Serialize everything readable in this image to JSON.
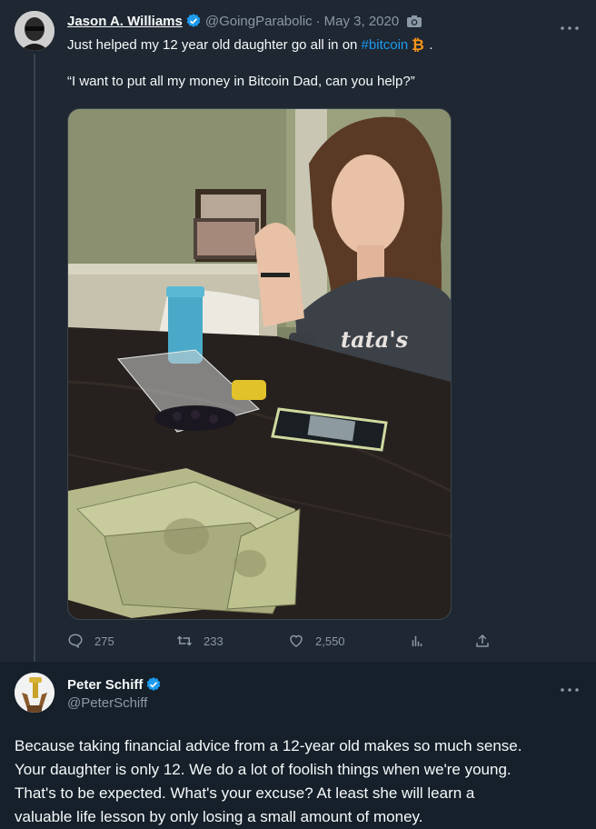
{
  "colors": {
    "bg_highlight": "#1e2732",
    "bg": "#15202b",
    "accent": "#1d9bf0",
    "muted": "#8b98a5",
    "text": "#f7f9f9"
  },
  "tweet1": {
    "name": "Jason A. Williams",
    "handle": "@GoingParabolic",
    "separator": "·",
    "date": "May 3, 2020",
    "text_pre": "Just helped my 12 year old daughter go all in on",
    "hashtag": "#bitcoin",
    "text_post": ".",
    "quote": "“I want to put all my money in Bitcoin Dad, can you help?”",
    "icons": [
      "verified-badge-icon",
      "camera-icon",
      "more-options-icon",
      "bitcoin-icon"
    ],
    "media_alt": "Girl at a table with berries, a phone, a water bottle and a pile of dollar bills",
    "stats": {
      "replies": "275",
      "retweets": "233",
      "likes": "2,550"
    }
  },
  "tweet2": {
    "name": "Peter Schiff",
    "handle": "@PeterSchiff",
    "lines": [
      "Because taking financial advice from a 12-year old makes so much sense.",
      "Your daughter is only 12.  We do a lot of foolish things when we're young.",
      "That's to be expected. What's your excuse?  At least she will learn a",
      "valuable life lesson by only losing a small amount of money."
    ]
  }
}
